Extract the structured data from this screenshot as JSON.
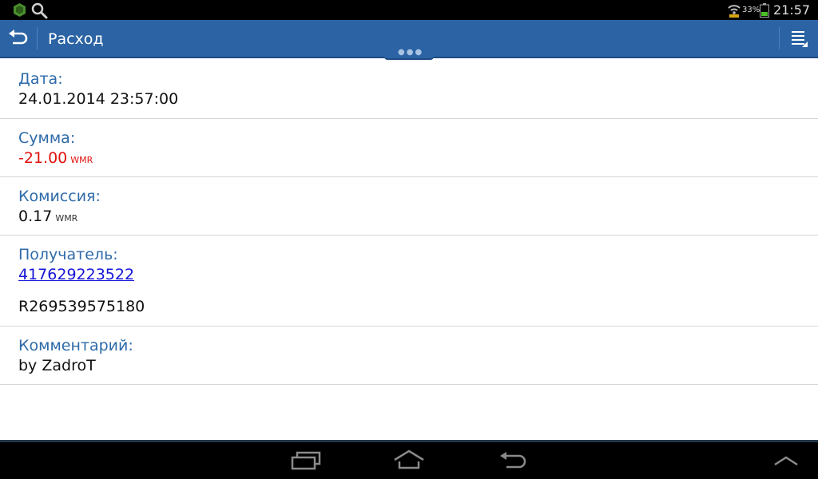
{
  "status_bar": {
    "battery_percent": "33%",
    "time": "21:57",
    "icons": [
      "app-icon",
      "search-icon",
      "wifi-icon",
      "battery-icon"
    ]
  },
  "action_bar": {
    "title": "Расход",
    "up_icon": "back-arrow-icon",
    "menu_icon": "menu-list-icon",
    "accent_color": "#2b63a4"
  },
  "details": {
    "date_label": "Дата:",
    "date_value": "24.01.2014 23:57:00",
    "sum_label": "Сумма:",
    "sum_value": "-21.00",
    "sum_unit": "WMR",
    "sum_color": "#e0120f",
    "fee_label": "Комиссия:",
    "fee_value": "0.17",
    "fee_unit": "WMR",
    "recipient_label": "Получатель:",
    "recipient_wmid": "417629223522",
    "recipient_purse": "R269539575180",
    "comment_label": "Комментарий:",
    "comment_value": "by ZadroT"
  },
  "nav_bar": {
    "icons": [
      "recent-apps-icon",
      "home-icon",
      "back-icon",
      "collapse-up-icon"
    ]
  }
}
